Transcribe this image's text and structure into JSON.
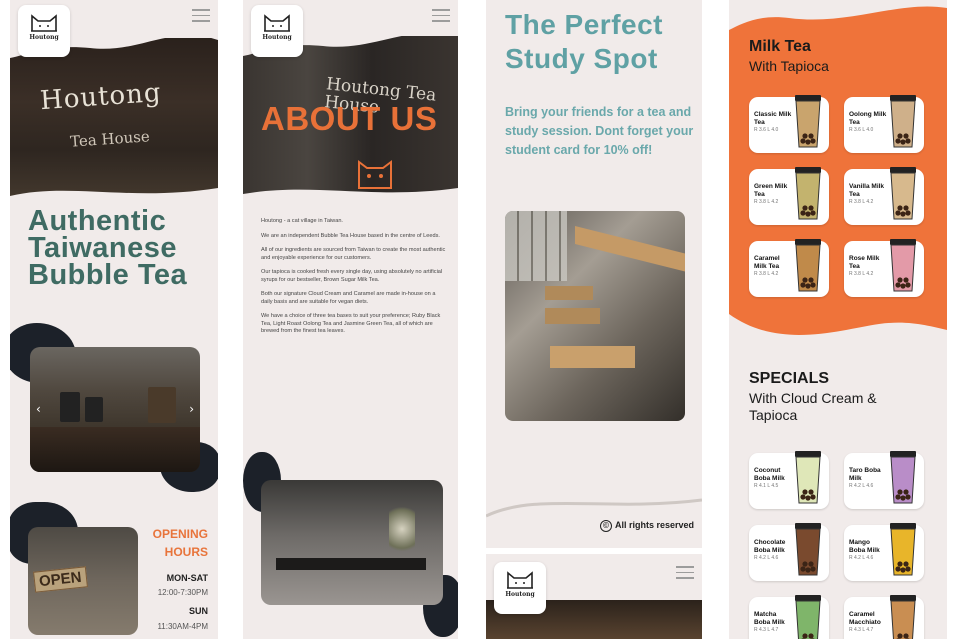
{
  "colors": {
    "teal": "#3f6b63",
    "orange": "#ef733a",
    "background": "#f1ebea",
    "dark": "#1c2129"
  },
  "brand": {
    "logo_text": "Houtong",
    "logo_icon": "cat-icon"
  },
  "screen1": {
    "hero_sign_main": "Houtong",
    "hero_sign_sub": "Tea House",
    "headline": "Authentic Taiwanese Bubble Tea",
    "carousel_prev": "‹",
    "carousel_next": "›",
    "open_sign": "OPEN",
    "hours_title": "OPENING HOURS",
    "hours": [
      {
        "day": "MON-SAT",
        "time": "12:00-7:30PM"
      },
      {
        "day": "SUN",
        "time": "11:30AM-4PM"
      }
    ]
  },
  "screen2": {
    "hero_sign": "Houtong Tea House",
    "title": "ABOUT US",
    "paragraphs": [
      "Houtong - a cat village in Taiwan.",
      "We are an independent Bubble Tea House based in the centre of Leeds.",
      "All of our ingredients are sourced from Taiwan to create the most authentic and enjoyable experience for our customers.",
      "Our tapioca is cooked fresh every single day, using absolutely no artificial syrups for our bestseller, Brown Sugar Milk Tea.",
      "Both our signature Cloud Cream and Caramel are made in-house on a daily basis and are suitable for vegan diets.",
      "We have a choice of three tea bases to suit your preference; Ruby Black Tea, Light Roast Oolong Tea and Jasmine Green Tea, all of which are brewed from the finest tea leaves."
    ]
  },
  "screen3": {
    "title": "The Perfect Study Spot",
    "body": "Bring your friends for a tea and study session. Dont forget your student card for 10% off!",
    "copyright_symbol": "©",
    "footer": "All rights reserved"
  },
  "screen4": {
    "milk_tea_title": "Milk Tea",
    "milk_tea_sub": "With Tapioca",
    "milk_tea_items": [
      {
        "name": "Classic Milk Tea",
        "price": "R 3.6 L 4.0",
        "cup_color": "#c9a46d"
      },
      {
        "name": "Oolong Milk Tea",
        "price": "R 3.6 L 4.0",
        "cup_color": "#cfb08a"
      },
      {
        "name": "Green Milk Tea",
        "price": "R 3.8 L 4.2",
        "cup_color": "#c3b36e"
      },
      {
        "name": "Vanilla Milk Tea",
        "price": "R 3.8 L 4.2",
        "cup_color": "#d7b98d"
      },
      {
        "name": "Caramel Milk Tea",
        "price": "R 3.8 L 4.2",
        "cup_color": "#c08a4a"
      },
      {
        "name": "Rose Milk Tea",
        "price": "R 3.8 L 4.2",
        "cup_color": "#e39aa8"
      }
    ],
    "specials_title": "SPECIALS",
    "specials_sub": "With Cloud Cream & Tapioca",
    "specials_items": [
      {
        "name": "Coconut Boba Milk",
        "price": "R 4.1 L 4.5",
        "cup_color": "#dfe7b8"
      },
      {
        "name": "Taro Boba Milk",
        "price": "R 4.2 L 4.6",
        "cup_color": "#b98dc8"
      },
      {
        "name": "Chocolate Boba Milk",
        "price": "R 4.2 L 4.6",
        "cup_color": "#7a4a2e"
      },
      {
        "name": "Mango Boba Milk",
        "price": "R 4.2 L 4.6",
        "cup_color": "#e8b52a"
      },
      {
        "name": "Matcha Boba Milk",
        "price": "R 4.3 L 4.7",
        "cup_color": "#7fb56a"
      },
      {
        "name": "Caramel Macchiato",
        "price": "R 4.3 L 4.7",
        "cup_color": "#c98e52"
      }
    ]
  }
}
